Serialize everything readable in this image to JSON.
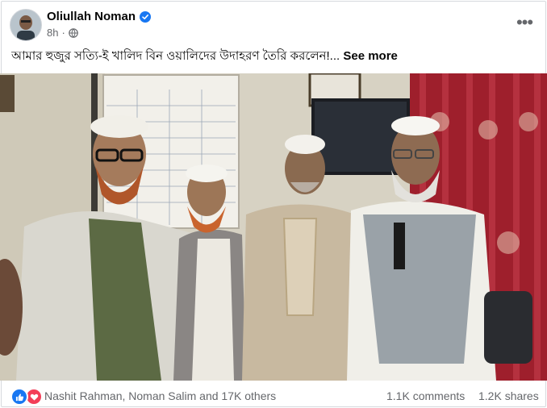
{
  "post": {
    "author": "Oliullah Noman",
    "time": "8h",
    "audience_icon": "globe-icon",
    "verified_icon": "verified-badge-icon",
    "more_icon": "more-options-icon",
    "caption": "আমার হুজুর সত্যি-ই খালিদ বিন ওয়ালিদের উদাহরণ তৈরি করলেন!...",
    "see_more": "See more"
  },
  "footer": {
    "reaction_icons": [
      "like-icon",
      "love-icon"
    ],
    "reactors": "Nashit Rahman, Noman Salim and 17K others",
    "comments": "1.1K comments",
    "shares": "1.2K shares"
  },
  "colors": {
    "text_primary": "#050505",
    "text_secondary": "#65676b",
    "brand_blue": "#1877f2",
    "love_red": "#f33e58"
  }
}
